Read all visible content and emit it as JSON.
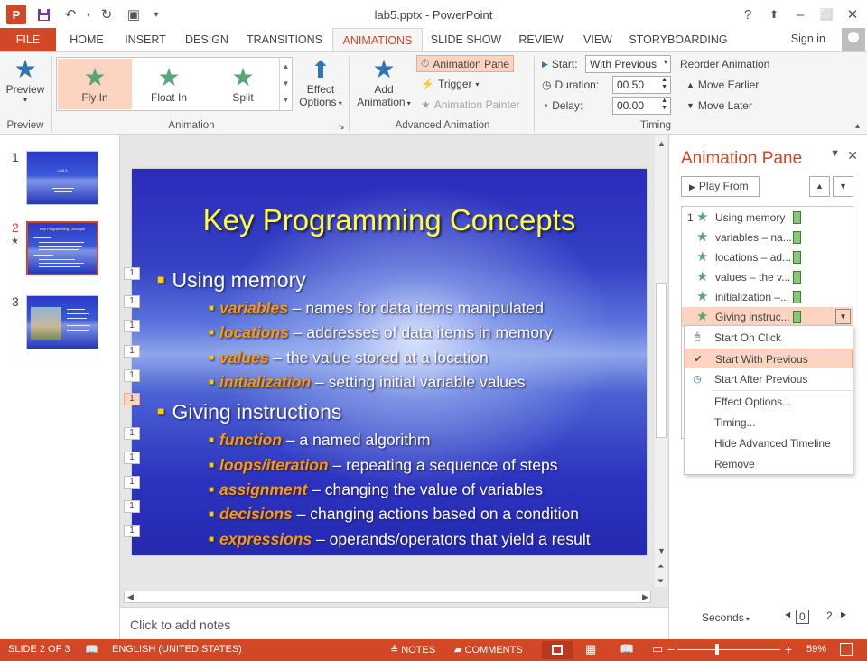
{
  "window": {
    "title": "lab5.pptx - PowerPoint",
    "help": "?",
    "minimize": "–",
    "restore": "⬜",
    "close": "✕",
    "ribbon_display": "⬆"
  },
  "app": {
    "logo": "P"
  },
  "qat": {
    "save": "💾",
    "undo": "↶",
    "redo": "↻",
    "present": "▣",
    "customize": "▾"
  },
  "tabs": [
    "FILE",
    "HOME",
    "INSERT",
    "DESIGN",
    "TRANSITIONS",
    "ANIMATIONS",
    "SLIDE SHOW",
    "REVIEW",
    "VIEW",
    "STORYBOARDING"
  ],
  "active_tab": "ANIMATIONS",
  "signin": "Sign in",
  "ribbon": {
    "preview": {
      "label": "Preview",
      "group": "Preview"
    },
    "animation_group": "Animation",
    "animations": [
      {
        "label": "Fly In",
        "selected": true
      },
      {
        "label": "Float In",
        "selected": false
      },
      {
        "label": "Split",
        "selected": false
      }
    ],
    "effect_options": {
      "label1": "Effect",
      "label2": "Options"
    },
    "add_animation": {
      "label1": "Add",
      "label2": "Animation"
    },
    "animation_pane_btn": "Animation Pane",
    "trigger": "Trigger",
    "animation_painter": "Animation Painter",
    "advanced_group": "Advanced Animation",
    "start_label": "Start:",
    "start_value": "With Previous",
    "duration_label": "Duration:",
    "duration_value": "00.50",
    "delay_label": "Delay:",
    "delay_value": "00.00",
    "timing_group": "Timing",
    "reorder": "Reorder Animation",
    "move_earlier": "Move Earlier",
    "move_later": "Move Later"
  },
  "thumbnails": [
    {
      "num": "1",
      "title": "LAB 5"
    },
    {
      "num": "2",
      "title": "Key Programming Concepts",
      "selected": true,
      "star": "★"
    },
    {
      "num": "3",
      "title": ""
    }
  ],
  "slide": {
    "title": "Key Programming Concepts",
    "bullet1": "Using memory",
    "sub1": [
      {
        "kw": "variables",
        "rest": " – names for data items manipulated"
      },
      {
        "kw": "locations",
        "rest": " – addresses of data items in memory"
      },
      {
        "kw": "values",
        "rest": " – the value stored at a location"
      },
      {
        "kw": "initialization",
        "rest": " – setting initial variable values"
      }
    ],
    "bullet2": "Giving instructions",
    "sub2": [
      {
        "kw": "function",
        "rest": " – a named algorithm"
      },
      {
        "kw": "loops/iteration",
        "rest": " – repeating a sequence of steps"
      },
      {
        "kw": "assignment",
        "rest": " – changing the value of variables"
      },
      {
        "kw": "decisions",
        "rest": " – changing actions based on a condition"
      },
      {
        "kw": "expressions",
        "rest": " – operands/operators that yield a result"
      }
    ],
    "tag": "1"
  },
  "notes_placeholder": "Click to add notes",
  "anim_pane": {
    "title": "Animation Pane",
    "play_from": "Play From",
    "items": [
      {
        "num": "1",
        "label": "Using memory"
      },
      {
        "num": "",
        "label": "variables – na..."
      },
      {
        "num": "",
        "label": "locations – ad..."
      },
      {
        "num": "",
        "label": "values – the v..."
      },
      {
        "num": "",
        "label": "initialization –..."
      },
      {
        "num": "",
        "label": "Giving instruc...",
        "selected": true
      }
    ],
    "menu": [
      {
        "label": "Start On Click",
        "icon": "🖱"
      },
      {
        "label": "Start With Previous",
        "icon": "✔",
        "selected": true
      },
      {
        "label": "Start After Previous",
        "icon": "◷"
      },
      {
        "label": "Effect Options...",
        "icon": ""
      },
      {
        "label": "Timing...",
        "icon": ""
      },
      {
        "label": "Hide Advanced Timeline",
        "icon": ""
      },
      {
        "label": "Remove",
        "icon": ""
      }
    ],
    "seconds": "Seconds",
    "timeline_start": "0",
    "timeline_end": "2"
  },
  "status": {
    "slide": "SLIDE 2 OF 3",
    "language": "ENGLISH (UNITED STATES)",
    "notes": "NOTES",
    "comments": "COMMENTS",
    "zoom": "59%"
  }
}
